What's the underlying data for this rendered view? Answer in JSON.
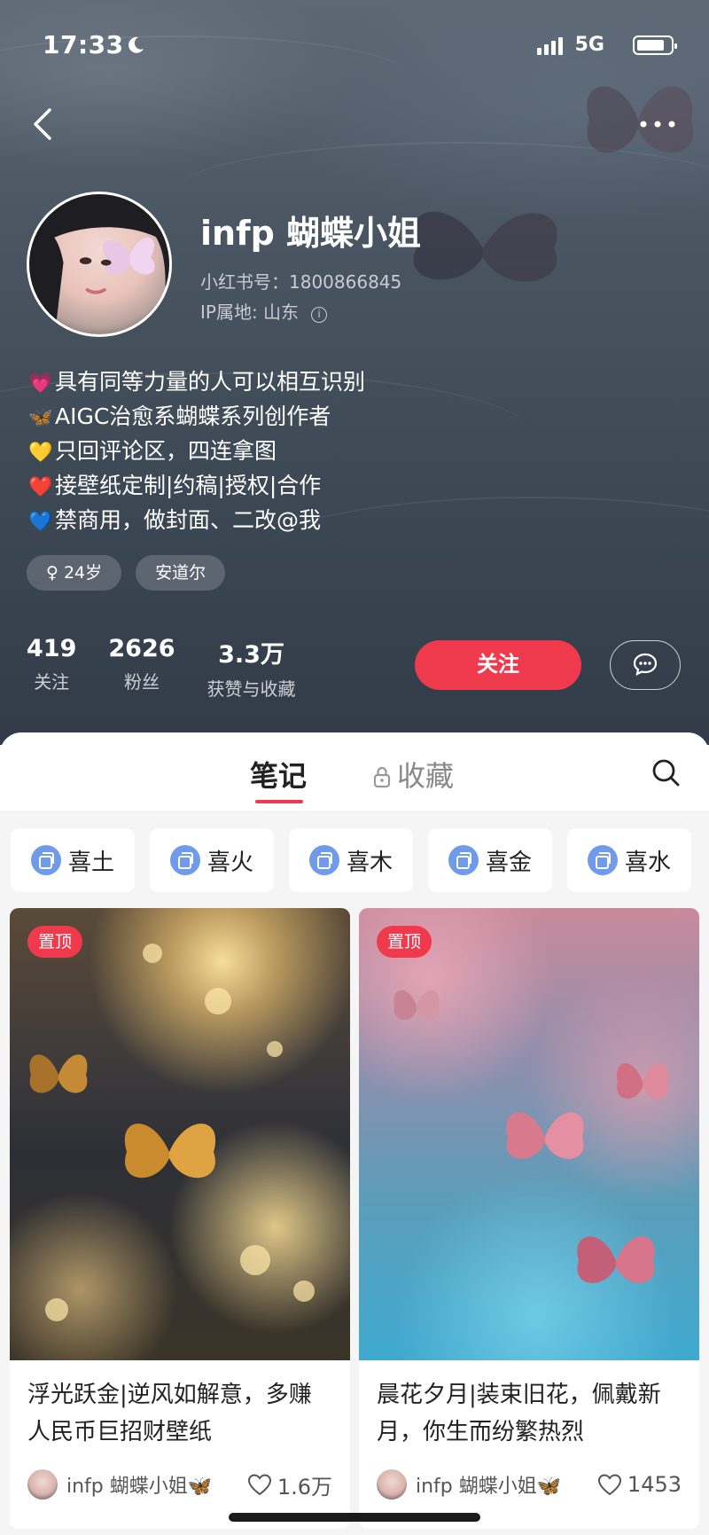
{
  "status_bar": {
    "time": "17:33",
    "network": "5G"
  },
  "profile": {
    "nickname": "infp 蝴蝶小姐",
    "red_id": "小红书号：1800866845",
    "ip": "IP属地: 山东",
    "bio": [
      {
        "emoji": "💗",
        "text": "具有同等力量的人可以相互识别"
      },
      {
        "emoji": "🦋",
        "text": "AIGC治愈系蝴蝶系列创作者"
      },
      {
        "emoji": "💛",
        "text": "只回评论区，四连拿图"
      },
      {
        "emoji": "❤️",
        "text": "接壁纸定制|约稿|授权|合作"
      },
      {
        "emoji": "💙",
        "text": "禁商用，做封面、二改@我"
      }
    ],
    "tags": [
      "♀ 24岁",
      "安道尔"
    ],
    "stats": [
      {
        "num": "419",
        "label": "关注"
      },
      {
        "num": "2626",
        "label": "粉丝"
      },
      {
        "num": "3.3万",
        "label": "获赞与收藏"
      }
    ],
    "follow_label": "关注"
  },
  "tabs": {
    "notes": "笔记",
    "favorites": "收藏"
  },
  "collections": [
    "喜土",
    "喜火",
    "喜木",
    "喜金",
    "喜水"
  ],
  "notes": [
    {
      "pin": "置顶",
      "title": "浮光跃金|逆风如解意，多赚人民币巨招财壁纸",
      "author": "infp 蝴蝶小姐🦋",
      "likes": "1.6万"
    },
    {
      "pin": "置顶",
      "title": "晨花夕月|装束旧花，佩戴新月，你生而纷繁热烈",
      "author": "infp 蝴蝶小姐🦋",
      "likes": "1453"
    }
  ],
  "colors": {
    "accent": "#ef3a4d",
    "collection_icon": "#6f9bea"
  }
}
